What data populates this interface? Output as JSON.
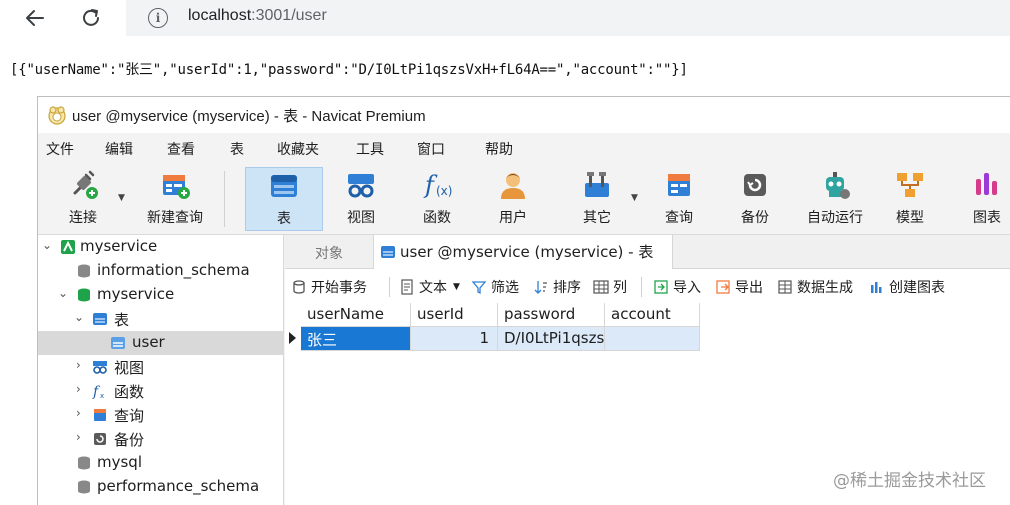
{
  "browser": {
    "url_host": "localhost",
    "url_rest": ":3001/user"
  },
  "response_json": "[{\"userName\":\"张三\",\"userId\":1,\"password\":\"D/I0LtPi1qszsVxH+fL64A==\",\"account\":\"\"}]",
  "navicat": {
    "title": "user @myservice (myservice) - 表 - Navicat Premium",
    "menu": [
      "文件",
      "编辑",
      "查看",
      "表",
      "收藏夹",
      "工具",
      "窗口",
      "帮助"
    ],
    "toolbar": [
      "连接",
      "新建查询",
      "表",
      "视图",
      "函数",
      "用户",
      "其它",
      "查询",
      "备份",
      "自动运行",
      "模型",
      "图表"
    ],
    "tree": {
      "connection": "myservice",
      "items": [
        "information_schema",
        "myservice",
        "表",
        "user",
        "视图",
        "函数",
        "查询",
        "备份",
        "mysql",
        "performance_schema"
      ]
    },
    "tabs": {
      "objects": "对象",
      "active": "user @myservice (myservice) - 表"
    },
    "subtoolbar": [
      "开始事务",
      "文本",
      "筛选",
      "排序",
      "列",
      "导入",
      "导出",
      "数据生成",
      "创建图表"
    ],
    "grid": {
      "columns": [
        "userName",
        "userId",
        "password",
        "account"
      ],
      "rows": [
        {
          "userName": "张三",
          "userId": "1",
          "password": "D/I0LtPi1qszs",
          "account": ""
        }
      ]
    }
  },
  "watermark": "@稀土掘金技术社区",
  "colors": {
    "accent": "#1978d4",
    "active_tool": "#cde4f7",
    "row_highlight": "#dbe9f8"
  }
}
